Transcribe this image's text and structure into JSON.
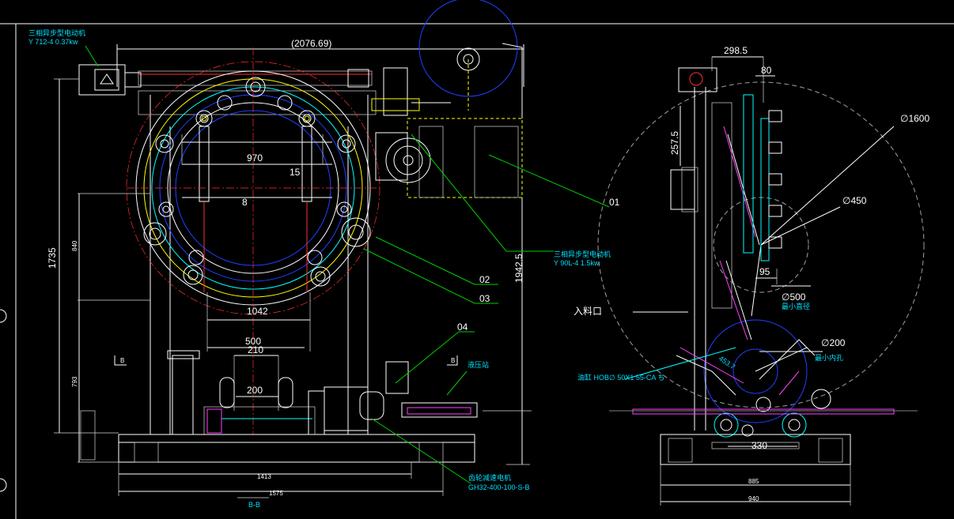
{
  "drawing": {
    "motor_top_left": {
      "name": "三相异步型电动机",
      "model": "Y 712-4  0.37kw"
    },
    "motor_right": {
      "name": "三相异步型电动机",
      "model": "Y 90L-4 1.5kw"
    },
    "gear_motor": {
      "name": "齿轮减速电机",
      "model": "GH32-400-100-S-B"
    },
    "hydraulic_station": "液压站",
    "feed_inlet": "入料口",
    "cylinder": "油缸 HOB∅ 50X1 55-CA ち",
    "min_outer_dia_label": "最小直径",
    "min_inner_hole_label": "最小内孔",
    "section_b": "B",
    "section_bb": "B-B",
    "balloons": [
      "01",
      "02",
      "03",
      "04"
    ]
  },
  "dims": {
    "overall_width": "(2076.69)",
    "d970": "970",
    "d15": "15",
    "d8": "8",
    "d1042": "1042",
    "d500": "500",
    "d210": "210",
    "d200": "200",
    "d1735": "1735",
    "d840": "840",
    "d793": "793",
    "d1942": "1942.5",
    "d1413": "1413",
    "d1575": "1575",
    "d2985": "298.5",
    "d80": "80",
    "d2575": "257.5",
    "dia1600": "∅1600",
    "dia450": "∅450",
    "d95": "95",
    "dia500": "∅500",
    "dia200": "∅200",
    "d453": "453.7",
    "d330": "330",
    "d885": "885",
    "d940": "940"
  }
}
